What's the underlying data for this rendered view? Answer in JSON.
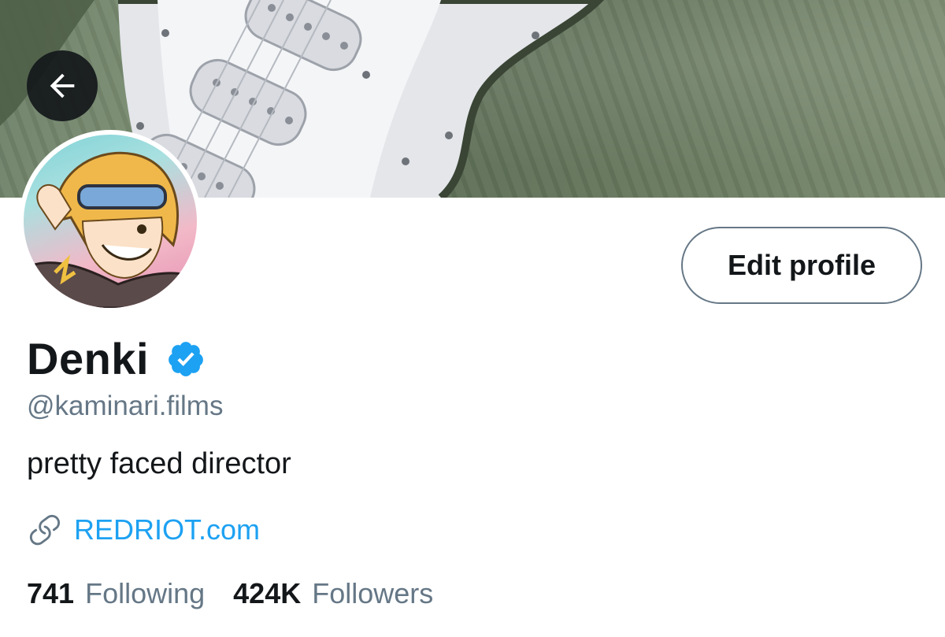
{
  "colors": {
    "accent": "#1da1f2",
    "secondary_text": "#657786",
    "primary_text": "#14171a",
    "banner_green": "#6f8169"
  },
  "header": {
    "back_icon": "arrow-left-icon"
  },
  "profile": {
    "edit_label": "Edit profile",
    "name": "Denki",
    "verified_icon": "verified-badge-icon",
    "handle": "@kaminari.films",
    "bio": "pretty faced director",
    "link_icon": "link-icon",
    "website": "REDRIOT.com"
  },
  "stats": {
    "following_count": "741",
    "following_label": "Following",
    "followers_count": "424K",
    "followers_label": "Followers"
  }
}
